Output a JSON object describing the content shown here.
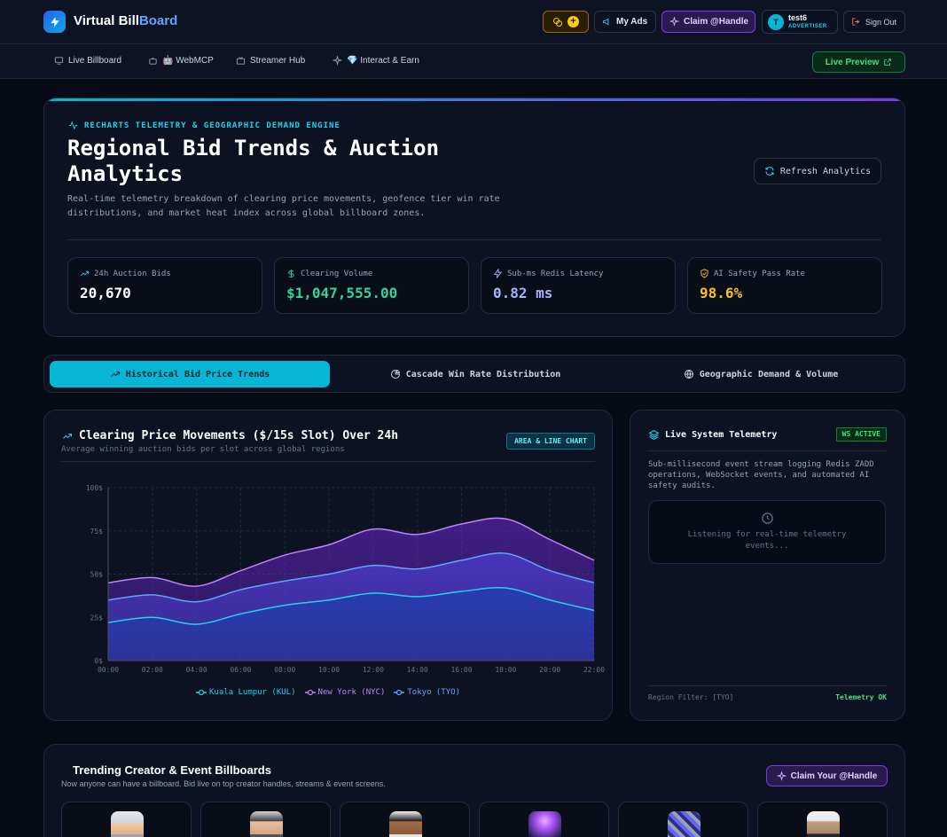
{
  "header": {
    "brand_main": "Virtual Bill",
    "brand_accent": "Board",
    "my_ads": "My Ads",
    "claim_handle": "Claim @Handle",
    "user_name": "test6",
    "user_role": "ADVERTISER",
    "user_initial": "T",
    "sign_out": "Sign Out",
    "coin_plus": "+"
  },
  "nav": {
    "items": [
      "Live Billboard",
      "🤖 WebMCP",
      "Streamer Hub",
      "💎 Interact & Earn"
    ],
    "live_preview": "Live Preview"
  },
  "hero": {
    "eyebrow": "RECHARTS TELEMETRY & GEOGRAPHIC DEMAND ENGINE",
    "title": "Regional Bid Trends & Auction Analytics",
    "description": "Real-time telemetry breakdown of clearing price movements, geofence tier win rate distributions, and market heat index across global billboard zones.",
    "refresh": "Refresh Analytics",
    "stats": [
      {
        "label": "24h Auction Bids",
        "value": "20,670",
        "color": "#ffffff"
      },
      {
        "label": "Clearing Volume",
        "value": "$1,047,555.00",
        "color": "#34d399"
      },
      {
        "label": "Sub-ms Redis Latency",
        "value": "0.82 ms",
        "color": "#a5b4fc"
      },
      {
        "label": "AI Safety Pass Rate",
        "value": "98.6%",
        "color": "#fbbf24"
      }
    ]
  },
  "tabs": [
    "Historical Bid Price Trends",
    "Cascade Win Rate Distribution",
    "Geographic Demand & Volume"
  ],
  "chart": {
    "title": "Clearing Price Movements ($/15s Slot) Over 24h",
    "subtitle": "Average winning auction bids per slot across global regions",
    "badge": "AREA & LINE CHART"
  },
  "chart_data": {
    "type": "area",
    "x": [
      "00:00",
      "02:00",
      "04:00",
      "06:00",
      "08:00",
      "10:00",
      "12:00",
      "14:00",
      "16:00",
      "18:00",
      "20:00",
      "22:00"
    ],
    "y_ticks": [
      "0$",
      "25$",
      "50$",
      "75$",
      "100$"
    ],
    "ylim": [
      0,
      100
    ],
    "grid": true,
    "legend_position": "bottom",
    "series": [
      {
        "name": "Kuala Lumpur (KUL)",
        "color": "#22d3ee",
        "values": [
          22,
          25,
          21,
          27,
          32,
          35,
          39,
          37,
          40,
          42,
          35,
          29
        ]
      },
      {
        "name": "New York (NYC)",
        "color": "#c084fc",
        "values": [
          45,
          48,
          43,
          52,
          61,
          67,
          76,
          73,
          79,
          82,
          70,
          58
        ]
      },
      {
        "name": "Tokyo (TYO)",
        "color": "#60a5fa",
        "values": [
          35,
          38,
          34,
          41,
          46,
          50,
          55,
          53,
          58,
          62,
          52,
          45
        ]
      }
    ]
  },
  "telemetry": {
    "title": "Live System Telemetry",
    "badge": "WS ACTIVE",
    "description": "Sub-millisecond event stream logging Redis ZADD operations, WebSocket events, and automated AI safety audits.",
    "listening": "Listening for real-time telemetry events...",
    "filter": "Region Filter: [TYO]",
    "status": "Telemetry OK"
  },
  "trending": {
    "title": "Trending Creator & Event Billboards",
    "subtitle": "Now anyone can have a billboard. Bid live on top creator handles, streams & event screens.",
    "claim": "Claim Your @Handle"
  }
}
